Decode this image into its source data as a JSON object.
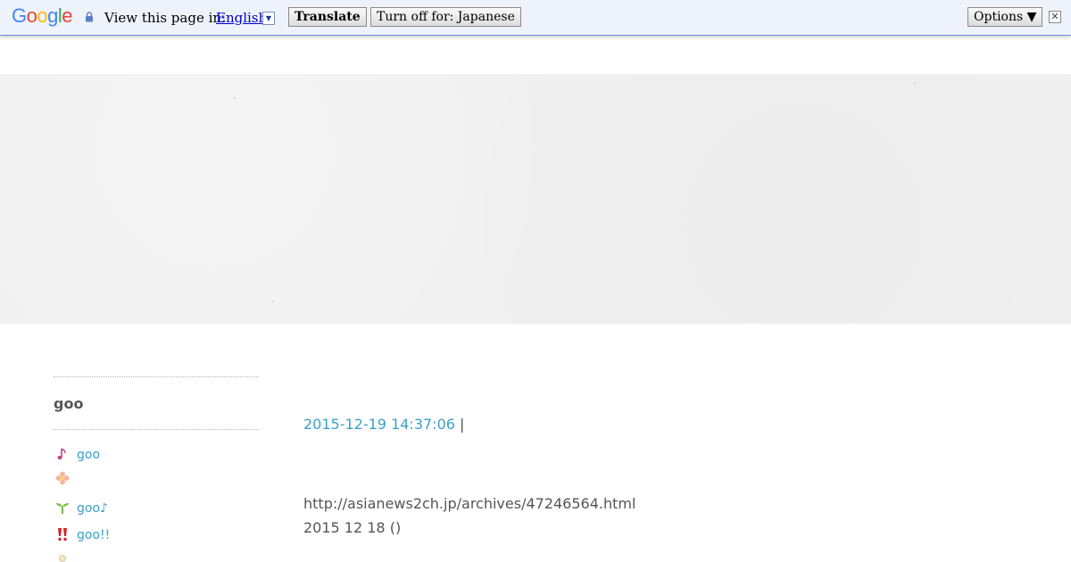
{
  "translate_bar": {
    "logo": [
      "G",
      "o",
      "o",
      "g",
      "l",
      "e"
    ],
    "logo_colors": [
      "#4285f4",
      "#ea4335",
      "#fbbc05",
      "#4285f4",
      "#34a853",
      "#ea4335"
    ],
    "prompt": "View this page in:",
    "language": "English",
    "translate_button": "Translate",
    "turn_off_button": "Turn off for: Japanese",
    "options_button": "Options ▼",
    "close_glyph": "✕"
  },
  "sidebar": {
    "title": "goo",
    "items": [
      {
        "label": "goo",
        "icon": "music-note-icon"
      },
      {
        "label": "",
        "icon": "flower-icon"
      },
      {
        "label": "goo♪",
        "icon": "sprout-icon"
      },
      {
        "label": "goo!!",
        "icon": "double-exclamation-icon"
      }
    ]
  },
  "post": {
    "date": "2015-12-19 14:37:06",
    "separator": "|",
    "source_url": "http://asianews2ch.jp/archives/47246564.html",
    "date_text": "2015 12 18 ()"
  },
  "colors": {
    "link": "#3aa0c8",
    "text": "#555555",
    "bar_bg": "#eef3fb"
  }
}
